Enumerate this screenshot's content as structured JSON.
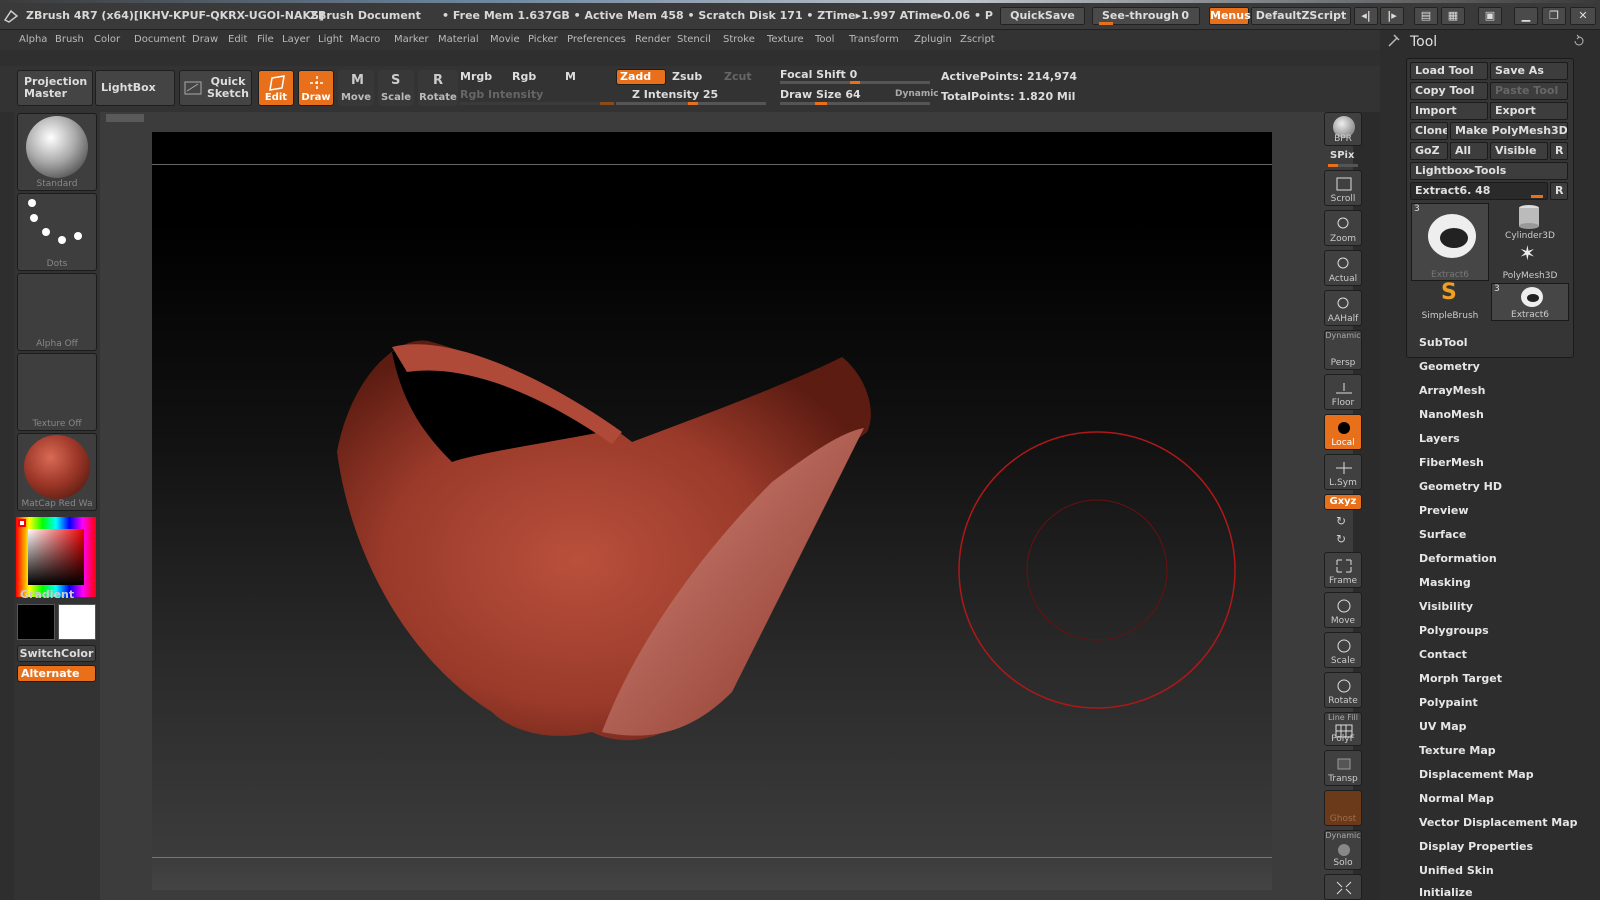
{
  "titlebar": {
    "app_title": "ZBrush 4R7 (x64)[IKHV-KPUF-QKRX-UGOI-NAKS]",
    "document": "ZBrush Document",
    "stats": "• Free Mem 1.637GB • Active Mem 458 • Scratch Disk 171 • ZTime▸1.997 ATime▸0.06 • P",
    "quicksave": "QuickSave",
    "see_through": "See-through",
    "see_through_value": "0",
    "menus": "Menus",
    "default_zscript": "DefaultZScript"
  },
  "menubar": [
    "Alpha",
    "Brush",
    "Color",
    "Document",
    "Draw",
    "Edit",
    "File",
    "Layer",
    "Light",
    "Macro",
    "Marker",
    "Material",
    "Movie",
    "Picker",
    "Preferences",
    "Render",
    "Stencil",
    "Stroke",
    "Texture",
    "Tool",
    "Transform",
    "Zplugin",
    "Zscript"
  ],
  "shelf": {
    "projection_master": "Projection Master",
    "lightbox": "LightBox",
    "quick_sketch": "Quick Sketch",
    "edit": "Edit",
    "draw": "Draw",
    "move": "Move",
    "scale": "Scale",
    "rotate": "Rotate",
    "mrgb": "Mrgb",
    "rgb": "Rgb",
    "m": "M",
    "rgb_intensity": "Rgb Intensity",
    "zadd": "Zadd",
    "zsub": "Zsub",
    "zcut": "Zcut",
    "z_intensity": "Z Intensity 25",
    "focal_shift": "Focal Shift 0",
    "draw_size": "Draw Size 64",
    "dynamic": "Dynamic",
    "active_points": "ActivePoints: 214,974",
    "total_points": "TotalPoints: 1.820 Mil"
  },
  "leftpanel": {
    "brush": "Standard",
    "stroke": "Dots",
    "alpha": "Alpha Off",
    "texture": "Texture Off",
    "material": "MatCap Red Wa",
    "gradient": "Gradient",
    "switchcolor": "SwitchColor",
    "alternate": "Alternate"
  },
  "righttools": {
    "bpr": "BPR",
    "spix": "SPix",
    "scroll": "Scroll",
    "zoom": "Zoom",
    "actual": "Actual",
    "aahalf": "AAHalf",
    "dynamic": "Dynamic",
    "persp": "Persp",
    "floor": "Floor",
    "local": "Local",
    "lsym": "L.Sym",
    "xyz": "Gxyz",
    "frame": "Frame",
    "move": "Move",
    "scale": "Scale",
    "rotate": "Rotate",
    "line_fill": "Line Fill",
    "polyf": "PolyF",
    "transp": "Transp",
    "ghost": "Ghost",
    "dynamic2": "Dynamic",
    "solo": "Solo"
  },
  "toolpanel": {
    "title": "Tool",
    "load_tool": "Load Tool",
    "save_as": "Save As",
    "copy_tool": "Copy Tool",
    "paste_tool": "Paste Tool",
    "import": "Import",
    "export": "Export",
    "clone": "Clone",
    "make_polymesh": "Make PolyMesh3D",
    "goz": "GoZ",
    "all": "All",
    "visible": "Visible",
    "r": "R",
    "lightbox_tools": "Lightbox▸Tools",
    "extract_slider": "Extract6. 48",
    "tools": [
      {
        "name": "Extract6",
        "count": "3"
      },
      {
        "name": "Cylinder3D",
        "count": ""
      },
      {
        "name": "PolyMesh3D",
        "count": ""
      },
      {
        "name": "SimpleBrush",
        "count": ""
      },
      {
        "name": "Extract6",
        "count": "3"
      }
    ],
    "menu": [
      "SubTool",
      "Geometry",
      "ArrayMesh",
      "NanoMesh",
      "Layers",
      "FiberMesh",
      "Geometry HD",
      "Preview",
      "Surface",
      "Deformation",
      "Masking",
      "Visibility",
      "Polygroups",
      "Contact",
      "Morph Target",
      "Polypaint",
      "UV Map",
      "Texture Map",
      "Displacement Map",
      "Normal Map",
      "Vector Displacement Map",
      "Display Properties",
      "Unified Skin",
      "Initialize"
    ]
  },
  "colors": {
    "accent": "#e8701a",
    "clay": "#a0392a",
    "brush_ring": "#b01818"
  }
}
